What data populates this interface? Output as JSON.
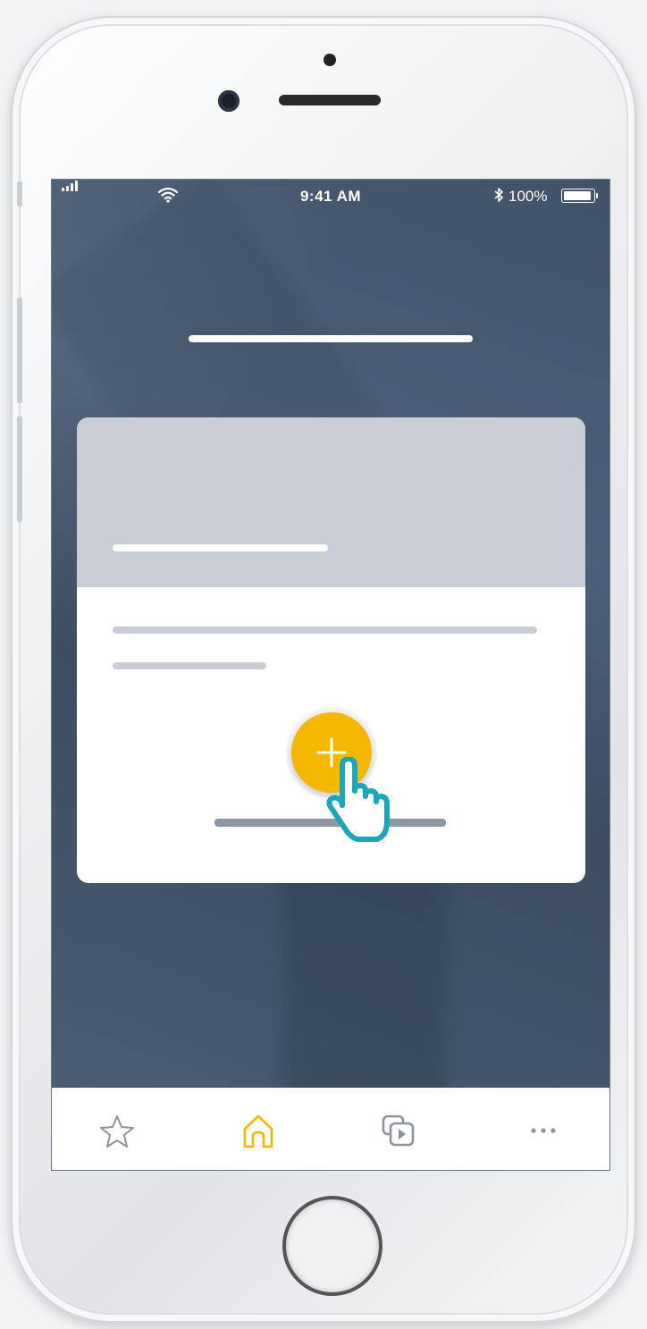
{
  "status_bar": {
    "time": "9:41 AM",
    "battery_percent": "100%",
    "battery_level": 1.0
  },
  "tab_bar": {
    "items": [
      {
        "icon": "star-icon",
        "active": false
      },
      {
        "icon": "home-icon",
        "active": true
      },
      {
        "icon": "media-icon",
        "active": false
      },
      {
        "icon": "more-icon",
        "active": false
      }
    ],
    "active_color": "#f5b800",
    "inactive_color": "#8a939e"
  },
  "card": {
    "action_icon": "plus-icon",
    "action_color": "#f5b800",
    "pointer_icon": "hand-pointer-icon",
    "pointer_color": "#1aa7b8"
  },
  "colors": {
    "background": "#45566d",
    "card_header": "#c9ced6"
  }
}
